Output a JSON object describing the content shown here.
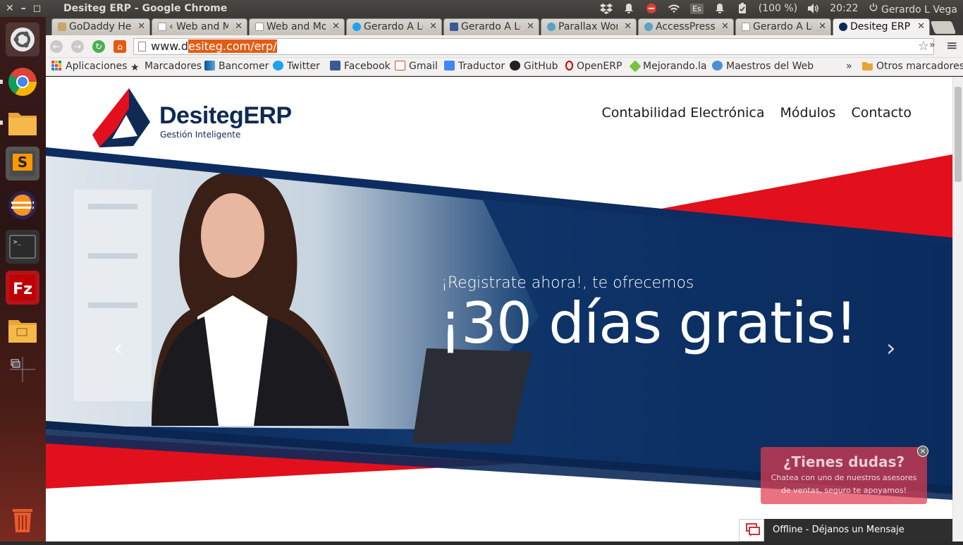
{
  "system": {
    "window_title": "Desiteg ERP - Google Chrome",
    "close": "✕",
    "minimize": "–",
    "maximize": "◻",
    "keyboard_layout": "Es",
    "battery": "(100 %)",
    "time": "20:22",
    "user": "Gerardo L Vega"
  },
  "tabs": [
    {
      "label": "GoDaddy Her",
      "color": "#c8a56b"
    },
    {
      "label": "‹ Web and Mo",
      "color": "#ffffff"
    },
    {
      "label": "Web and Mov",
      "color": "#ffffff"
    },
    {
      "label": "Gerardo A Lóp",
      "color": "#1da1f2"
    },
    {
      "label": "Gerardo A Lop",
      "color": "#3b5998"
    },
    {
      "label": "Parallax Word",
      "color": "#5aa0c8"
    },
    {
      "label": "AccessPress P",
      "color": "#5aa0c8"
    },
    {
      "label": "Gerardo A Lop",
      "color": "#ffffff"
    },
    {
      "label": "Desiteg ERP",
      "color": "#0e2a55"
    }
  ],
  "omnibox": {
    "prefix": "www.d",
    "selected": "esiteg.com/erp/"
  },
  "toolbar": {
    "more": "»",
    "menu": "≡"
  },
  "bookmarks": [
    {
      "label": "Aplicaciones",
      "color": "#e8453c"
    },
    {
      "label": "Marcadores",
      "color": "#555555"
    },
    {
      "label": "Bancomer",
      "color": "#0a4f9a"
    },
    {
      "label": "Twitter",
      "color": "#1da1f2"
    },
    {
      "label": "Facebook",
      "color": "#3b5998"
    },
    {
      "label": "Gmail",
      "color": "#d44638"
    },
    {
      "label": "Traductor",
      "color": "#4285f4"
    },
    {
      "label": "GitHub",
      "color": "#222222"
    },
    {
      "label": "OpenERP",
      "color": "#cc0000"
    },
    {
      "label": "Mejorando.la",
      "color": "#7ac143"
    },
    {
      "label": "Maestros del Web",
      "color": "#4a90d9"
    }
  ],
  "bookmarks_more": "»",
  "bookmarks_other": "Otros marcadores",
  "site": {
    "logo_word": "DesitegERP",
    "logo_tagline": "Gestión Inteligente",
    "nav": [
      "Contabilidad Electrónica",
      "Módulos",
      "Contacto"
    ],
    "hero_kicker": "¡Registrate ahora!, te ofrecemos",
    "hero_big": "¡30 días gratis!",
    "prev_arrow": "‹",
    "next_arrow": "›"
  },
  "chat": {
    "title": "¿Tienes dudas?",
    "line1": "Chatea con uno de nuestros asesores",
    "line2": "de ventas, seguro te apoyamos!",
    "close": "×",
    "bar_label": "Offline - Déjanos un Mensaje"
  },
  "colors": {
    "brand_navy": "#0e2a55",
    "brand_red": "#e1101c",
    "selection": "#e55b14"
  }
}
